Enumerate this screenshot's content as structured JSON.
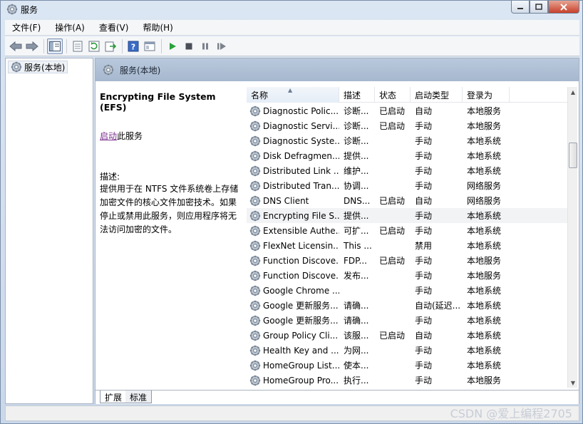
{
  "window": {
    "title": "服务"
  },
  "menu": [
    "文件(F)",
    "操作(A)",
    "查看(V)",
    "帮助(H)"
  ],
  "toolbar": {
    "icons": [
      "back-icon",
      "forward-icon",
      "show-console-tree-icon",
      "properties-icon",
      "refresh-icon",
      "export-icon",
      "help-icon",
      "view-icon",
      "play-icon",
      "stop-icon",
      "pause-icon",
      "restart-icon"
    ]
  },
  "tree": {
    "root": "服务(本地)"
  },
  "main": {
    "header": "服务(本地)",
    "detail": {
      "service_name": "Encrypting File System (EFS)",
      "start_link": "启动",
      "start_suffix": "此服务",
      "desc_label": "描述:",
      "desc_text": "提供用于在 NTFS 文件系统卷上存储加密文件的核心文件加密技术。如果停止或禁用此服务，则应用程序将无法访问加密的文件。"
    },
    "columns": {
      "name": "名称",
      "desc": "描述",
      "status": "状态",
      "startup": "启动类型",
      "logon": "登录为"
    },
    "rows": [
      {
        "name": "Diagnostic Polic...",
        "desc": "诊断...",
        "status": "已启动",
        "startup": "自动",
        "logon": "本地服务"
      },
      {
        "name": "Diagnostic Servi...",
        "desc": "诊断...",
        "status": "已启动",
        "startup": "手动",
        "logon": "本地服务"
      },
      {
        "name": "Diagnostic Syste...",
        "desc": "诊断...",
        "status": "",
        "startup": "手动",
        "logon": "本地系统"
      },
      {
        "name": "Disk Defragmen...",
        "desc": "提供...",
        "status": "",
        "startup": "手动",
        "logon": "本地系统"
      },
      {
        "name": "Distributed Link ...",
        "desc": "维护...",
        "status": "",
        "startup": "手动",
        "logon": "本地系统"
      },
      {
        "name": "Distributed Tran...",
        "desc": "协调...",
        "status": "",
        "startup": "手动",
        "logon": "网络服务"
      },
      {
        "name": "DNS Client",
        "desc": "DNS...",
        "status": "已启动",
        "startup": "自动",
        "logon": "网络服务"
      },
      {
        "name": "Encrypting File S...",
        "desc": "提供...",
        "status": "",
        "startup": "手动",
        "logon": "本地系统"
      },
      {
        "name": "Extensible Authe...",
        "desc": "可扩...",
        "status": "已启动",
        "startup": "手动",
        "logon": "本地系统"
      },
      {
        "name": "FlexNet Licensin...",
        "desc": "This ...",
        "status": "",
        "startup": "禁用",
        "logon": "本地系统"
      },
      {
        "name": "Function Discove...",
        "desc": "FDP...",
        "status": "已启动",
        "startup": "手动",
        "logon": "本地服务"
      },
      {
        "name": "Function Discove...",
        "desc": "发布...",
        "status": "",
        "startup": "手动",
        "logon": "本地服务"
      },
      {
        "name": "Google Chrome ...",
        "desc": "",
        "status": "",
        "startup": "手动",
        "logon": "本地系统"
      },
      {
        "name": "Google 更新服务...",
        "desc": "请确...",
        "status": "",
        "startup": "自动(延迟...",
        "logon": "本地系统"
      },
      {
        "name": "Google 更新服务...",
        "desc": "请确...",
        "status": "",
        "startup": "手动",
        "logon": "本地系统"
      },
      {
        "name": "Group Policy Cli...",
        "desc": "该服...",
        "status": "已启动",
        "startup": "自动",
        "logon": "本地系统"
      },
      {
        "name": "Health Key and ...",
        "desc": "为网...",
        "status": "",
        "startup": "手动",
        "logon": "本地系统"
      },
      {
        "name": "HomeGroup List...",
        "desc": "使本...",
        "status": "",
        "startup": "手动",
        "logon": "本地系统"
      },
      {
        "name": "HomeGroup Pro...",
        "desc": "执行...",
        "status": "",
        "startup": "手动",
        "logon": "本地服务"
      }
    ],
    "selected_row": 7,
    "tabs": [
      "扩展",
      "标准"
    ]
  },
  "watermark": "CSDN @爱上编程2705"
}
